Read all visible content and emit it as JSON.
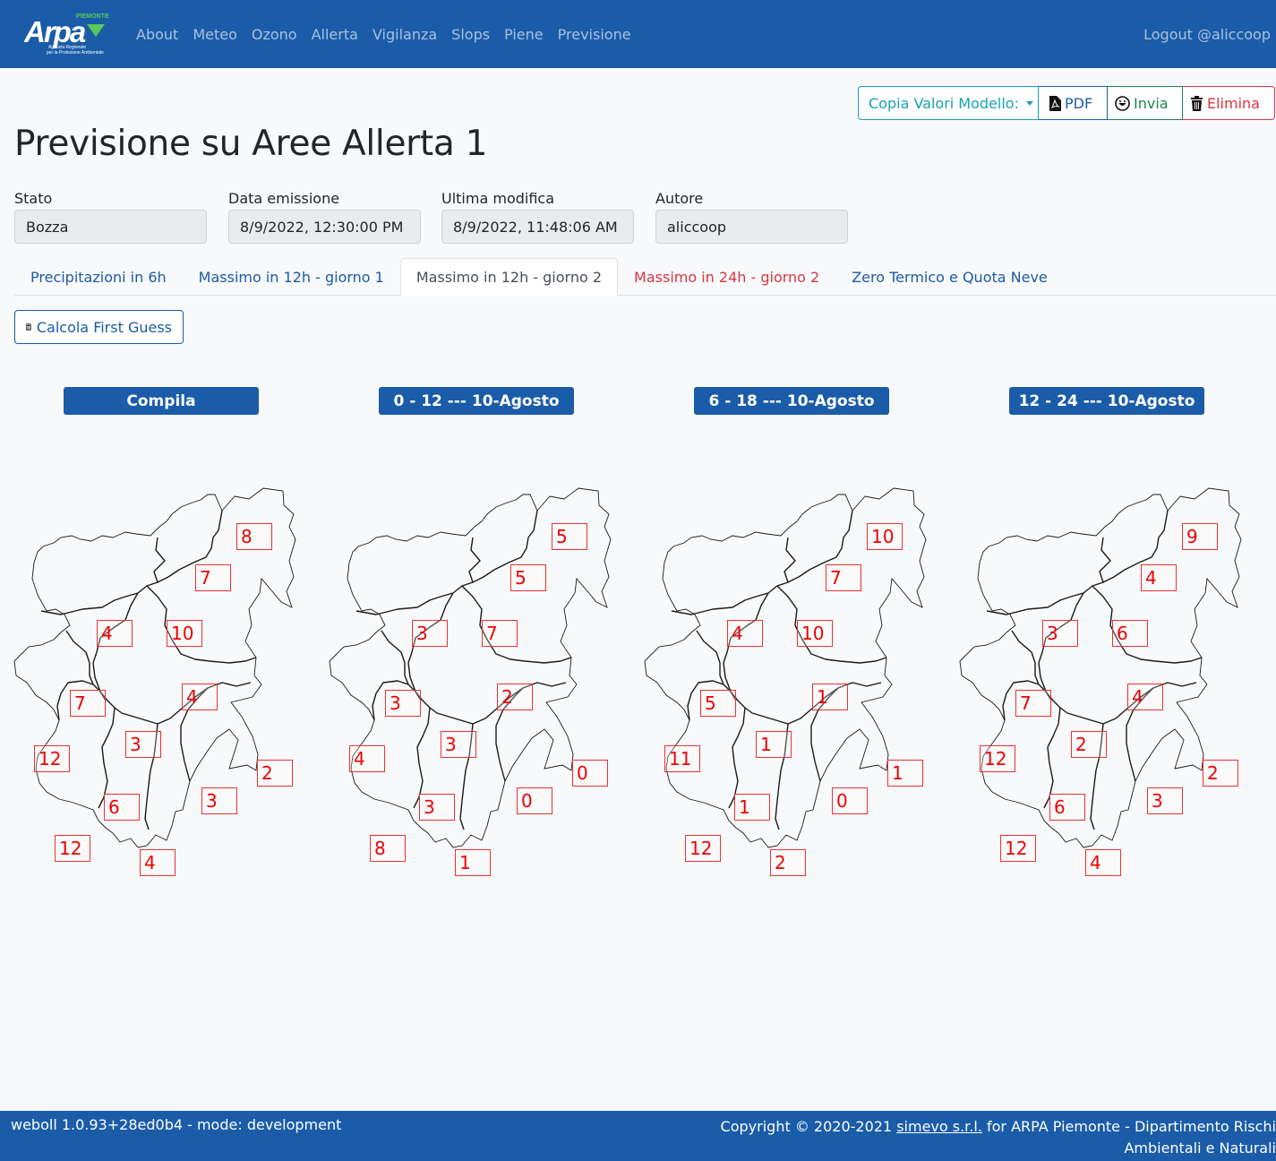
{
  "navbar": {
    "logo_text": "Arpa",
    "logo_region": "PIEMONTE",
    "logo_subtitle_1": "Agenzia Regionale",
    "logo_subtitle_2": "per la Protezione Ambientale",
    "links": [
      "About",
      "Meteo",
      "Ozono",
      "Allerta",
      "Vigilanza",
      "Slops",
      "Piene",
      "Previsione"
    ],
    "logout": "Logout @aliccoop"
  },
  "actions": {
    "copy_label": "Copia Valori Modello:",
    "pdf_label": "PDF",
    "send_label": "Invia",
    "delete_label": "Elimina"
  },
  "page_title": "Previsione su Aree Allerta 1",
  "meta": {
    "stato": {
      "label": "Stato",
      "value": "Bozza"
    },
    "data_emissione": {
      "label": "Data emissione",
      "value": "8/9/2022, 12:30:00 PM"
    },
    "ultima_modifica": {
      "label": "Ultima modifica",
      "value": "8/9/2022, 11:48:06 AM"
    },
    "autore": {
      "label": "Autore",
      "value": "aliccoop"
    }
  },
  "tabs": [
    {
      "label": "Precipitazioni in 6h"
    },
    {
      "label": "Massimo in 12h - giorno 1"
    },
    {
      "label": "Massimo in 12h - giorno 2",
      "active": true
    },
    {
      "label": "Massimo in 24h - giorno 2",
      "alert": true
    },
    {
      "label": "Zero Termico e Quota Neve"
    }
  ],
  "calc_button": "Calcola First Guess",
  "panels": [
    {
      "title": "Compila",
      "values": [
        "8",
        "7",
        "4",
        "10",
        "7",
        "4",
        "3",
        "12",
        "2",
        "6",
        "3",
        "12",
        "4"
      ]
    },
    {
      "title": "0 - 12 --- 10-Agosto",
      "values": [
        "5",
        "5",
        "3",
        "7",
        "3",
        "2",
        "3",
        "4",
        "0",
        "3",
        "0",
        "8",
        "1"
      ]
    },
    {
      "title": "6 - 18 --- 10-Agosto",
      "values": [
        "10",
        "7",
        "4",
        "10",
        "5",
        "1",
        "1",
        "11",
        "1",
        "1",
        "0",
        "12",
        "2"
      ]
    },
    {
      "title": "12 - 24 --- 10-Agosto",
      "values": [
        "9",
        "4",
        "3",
        "6",
        "7",
        "4",
        "2",
        "12",
        "2",
        "6",
        "3",
        "12",
        "4"
      ]
    }
  ],
  "footer": {
    "version": "weboll 1.0.93+28ed0b4 - mode: development",
    "copyright_prefix": "Copyright © 2020-2021",
    "company_link": "simevo s.r.l.",
    "copyright_suffix": "for ARPA Piemonte - Dipartimento Rischi Ambientali e Naturali"
  },
  "colors": {
    "brand": "#1a5ca8",
    "value_box": "#ee0000",
    "info": "#17a2b8",
    "success": "#198754",
    "danger": "#dc3545"
  }
}
